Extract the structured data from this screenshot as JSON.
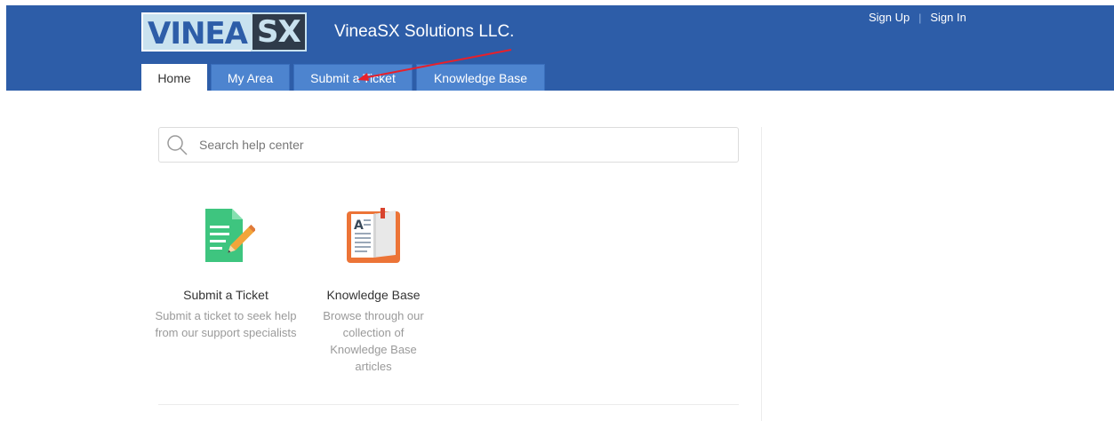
{
  "header": {
    "logo": {
      "part1": "VINEA",
      "part2": "SX"
    },
    "company_name": "VineaSX Solutions LLC.",
    "auth": {
      "sign_up": "Sign Up",
      "separator": "|",
      "sign_in": "Sign In"
    },
    "tabs": [
      {
        "label": "Home",
        "active": true
      },
      {
        "label": "My Area"
      },
      {
        "label": "Submit a Ticket"
      },
      {
        "label": "Knowledge Base"
      }
    ],
    "annotation_arrow_color": "#e8202a"
  },
  "search": {
    "placeholder": "Search help center"
  },
  "cards": [
    {
      "icon": "ticket-document-pencil-icon",
      "title": "Submit a Ticket",
      "description": "Submit a ticket to seek help from our support specialists"
    },
    {
      "icon": "open-book-icon",
      "title": "Knowledge Base",
      "description": "Browse through our collection of Knowledge Base articles"
    }
  ],
  "colors": {
    "header_bg": "#2d5da8",
    "tab_bg": "#4d84cf",
    "ticket_icon": "#3ec57f",
    "book_icon": "#ec7437"
  }
}
